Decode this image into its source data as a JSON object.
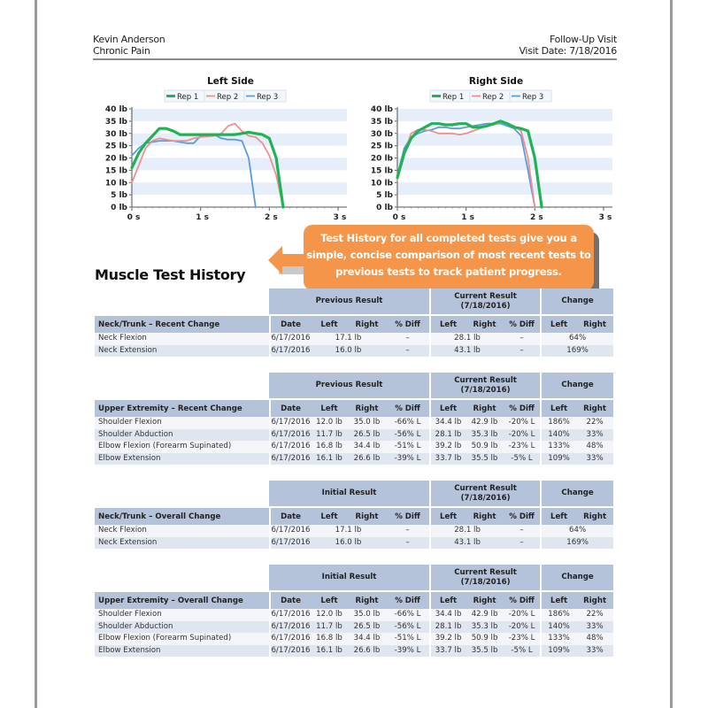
{
  "header": {
    "patient_name": "Kevin Anderson",
    "condition": "Chronic Pain",
    "visit_type": "Follow-Up Visit",
    "visit_date": "Visit Date: 7/18/2016"
  },
  "chart_data": [
    {
      "type": "line",
      "title": "Left Side",
      "xlabel": "",
      "ylabel": "",
      "xlim": [
        0,
        3
      ],
      "ylim": [
        0,
        40
      ],
      "x_ticks": [
        "0 s",
        "1 s",
        "2 s",
        "3 s"
      ],
      "y_ticks": [
        "0 lb",
        "5 lb",
        "10 lb",
        "15 lb",
        "20 lb",
        "25 lb",
        "30 lb",
        "35 lb",
        "40 lb"
      ],
      "legend": "top",
      "grid": "horizontal-bands",
      "series": [
        {
          "name": "Rep 1",
          "color": "#1fb356",
          "x": [
            0,
            0.1,
            0.2,
            0.3,
            0.4,
            0.5,
            0.6,
            0.7,
            0.8,
            0.9,
            1.0,
            1.2,
            1.4,
            1.5,
            1.6,
            1.7,
            1.8,
            1.9,
            2.0,
            2.1,
            2.2
          ],
          "y": [
            16,
            22,
            26,
            29,
            32,
            32,
            31,
            29.5,
            29.5,
            29.5,
            29.5,
            29.5,
            29.5,
            29.5,
            30,
            30.5,
            30,
            29.5,
            28,
            20,
            0
          ]
        },
        {
          "name": "Rep 2",
          "color": "#ef8f8f",
          "x": [
            0,
            0.1,
            0.2,
            0.3,
            0.4,
            0.5,
            0.6,
            0.7,
            0.8,
            0.9,
            1.0,
            1.2,
            1.3,
            1.4,
            1.5,
            1.6,
            1.7,
            1.8,
            1.9,
            2.0,
            2.1,
            2.2
          ],
          "y": [
            10,
            17,
            24,
            27,
            28,
            27.5,
            27,
            27,
            27,
            28,
            28.5,
            29,
            30,
            33,
            34,
            31,
            29,
            28.5,
            26,
            21,
            13,
            0
          ]
        },
        {
          "name": "Rep 3",
          "color": "#5b9bdc",
          "x": [
            0,
            0.1,
            0.2,
            0.3,
            0.4,
            0.5,
            0.6,
            0.7,
            0.8,
            0.9,
            1.0,
            1.1,
            1.2,
            1.3,
            1.4,
            1.5,
            1.6,
            1.7,
            1.75,
            1.8
          ],
          "y": [
            21,
            24,
            26,
            26.5,
            27,
            27,
            27,
            26.5,
            26,
            26,
            29,
            29.5,
            29.5,
            28,
            27.5,
            27.5,
            27,
            20,
            10,
            0
          ]
        }
      ]
    },
    {
      "type": "line",
      "title": "Right Side",
      "xlabel": "",
      "ylabel": "",
      "xlim": [
        0,
        3
      ],
      "ylim": [
        0,
        40
      ],
      "x_ticks": [
        "0 s",
        "1 s",
        "2 s",
        "3 s"
      ],
      "y_ticks": [
        "0 lb",
        "5 lb",
        "10 lb",
        "15 lb",
        "20 lb",
        "25 lb",
        "30 lb",
        "35 lb",
        "40 lb"
      ],
      "legend": "top",
      "grid": "horizontal-bands",
      "series": [
        {
          "name": "Rep 1",
          "color": "#1fb356",
          "x": [
            0,
            0.1,
            0.2,
            0.3,
            0.4,
            0.5,
            0.6,
            0.7,
            0.8,
            0.9,
            1.0,
            1.1,
            1.2,
            1.3,
            1.4,
            1.5,
            1.6,
            1.7,
            1.8,
            1.9,
            2.0,
            2.05,
            2.1
          ],
          "y": [
            12,
            22,
            28,
            31,
            32.5,
            34,
            34,
            33.5,
            33.5,
            34,
            34,
            32.5,
            32.5,
            33,
            34,
            35,
            34,
            32.5,
            32,
            31,
            20,
            10,
            0
          ]
        },
        {
          "name": "Rep 2",
          "color": "#ef8f8f",
          "x": [
            0,
            0.1,
            0.2,
            0.3,
            0.4,
            0.5,
            0.6,
            0.7,
            0.8,
            0.9,
            1.0,
            1.1,
            1.2,
            1.3,
            1.4,
            1.5,
            1.6,
            1.7,
            1.8,
            1.9,
            2.0
          ],
          "y": [
            11,
            22,
            30,
            31.5,
            31.5,
            31,
            30,
            30,
            30,
            29.5,
            30,
            31,
            32,
            33,
            33.5,
            34.5,
            34,
            33,
            31,
            20,
            0
          ]
        },
        {
          "name": "Rep 3",
          "color": "#5b9bdc",
          "x": [
            0,
            0.1,
            0.2,
            0.3,
            0.4,
            0.5,
            0.6,
            0.7,
            0.8,
            0.9,
            1.0,
            1.1,
            1.2,
            1.3,
            1.4,
            1.5,
            1.6,
            1.7,
            1.8,
            1.9,
            2.0
          ],
          "y": [
            13,
            24,
            28.5,
            30,
            31,
            31.5,
            32.5,
            32.5,
            32,
            32,
            32.5,
            33,
            33.5,
            34,
            34,
            34,
            33,
            32,
            29,
            15,
            0
          ]
        }
      ]
    }
  ],
  "callout": {
    "text_lines": [
      "Test History for all completed tests give you a",
      "simple, concise comparison of most recent tests to",
      "previous tests to track patient progress."
    ],
    "color": "#f4954a"
  },
  "section_title": "Muscle Test History",
  "tables": [
    {
      "baseline_group": "Previous Result",
      "current_group": "Current Result",
      "current_date": "(7/18/2016)",
      "change_group": "Change",
      "row_header": "Neck/Trunk – Recent Change",
      "columns": [
        "Date",
        "Left",
        "Right",
        "% Diff",
        "Left",
        "Right",
        "% Diff",
        "Left",
        "Right"
      ],
      "merged": true,
      "rows": [
        {
          "name": "Neck Flexion",
          "date": "6/17/2016",
          "prev": "17.1 lb",
          "prev_diff": "–",
          "curr": "28.1 lb",
          "curr_diff": "–",
          "change": "64%"
        },
        {
          "name": "Neck Extension",
          "date": "6/17/2016",
          "prev": "16.0 lb",
          "prev_diff": "–",
          "curr": "43.1 lb",
          "curr_diff": "–",
          "change": "169%"
        }
      ]
    },
    {
      "baseline_group": "Previous Result",
      "current_group": "Current Result",
      "current_date": "(7/18/2016)",
      "change_group": "Change",
      "row_header": "Upper Extremity – Recent Change",
      "columns": [
        "Date",
        "Left",
        "Right",
        "% Diff",
        "Left",
        "Right",
        "% Diff",
        "Left",
        "Right"
      ],
      "merged": false,
      "rows": [
        {
          "name": "Shoulder Flexion",
          "cells": [
            "6/17/2016",
            "12.0 lb",
            "35.0 lb",
            "-66% L",
            "34.4 lb",
            "42.9 lb",
            "-20% L",
            "186%",
            "22%"
          ]
        },
        {
          "name": "Shoulder Abduction",
          "cells": [
            "6/17/2016",
            "11.7 lb",
            "26.5 lb",
            "-56% L",
            "28.1 lb",
            "35.3 lb",
            "-20% L",
            "140%",
            "33%"
          ]
        },
        {
          "name": "Elbow Flexion (Forearm Supinated)",
          "cells": [
            "6/17/2016",
            "16.8 lb",
            "34.4 lb",
            "-51% L",
            "39.2 lb",
            "50.9 lb",
            "-23% L",
            "133%",
            "48%"
          ]
        },
        {
          "name": "Elbow Extension",
          "cells": [
            "6/17/2016",
            "16.1 lb",
            "26.6 lb",
            "-39% L",
            "33.7 lb",
            "35.5 lb",
            "-5% L",
            "109%",
            "33%"
          ]
        }
      ]
    },
    {
      "baseline_group": "Initial Result",
      "current_group": "Current Result",
      "current_date": "(7/18/2016)",
      "change_group": "Change",
      "row_header": "Neck/Trunk – Overall Change",
      "columns": [
        "Date",
        "Left",
        "Right",
        "% Diff",
        "Left",
        "Right",
        "% Diff",
        "Left",
        "Right"
      ],
      "merged": true,
      "rows": [
        {
          "name": "Neck Flexion",
          "date": "6/17/2016",
          "prev": "17.1 lb",
          "prev_diff": "–",
          "curr": "28.1 lb",
          "curr_diff": "–",
          "change": "64%"
        },
        {
          "name": "Neck Extension",
          "date": "6/17/2016",
          "prev": "16.0 lb",
          "prev_diff": "–",
          "curr": "43.1 lb",
          "curr_diff": "–",
          "change": "169%"
        }
      ]
    },
    {
      "baseline_group": "Initial Result",
      "current_group": "Current Result",
      "current_date": "(7/18/2016)",
      "change_group": "Change",
      "row_header": "Upper Extremity – Overall Change",
      "columns": [
        "Date",
        "Left",
        "Right",
        "% Diff",
        "Left",
        "Right",
        "% Diff",
        "Left",
        "Right"
      ],
      "merged": false,
      "rows": [
        {
          "name": "Shoulder Flexion",
          "cells": [
            "6/17/2016",
            "12.0 lb",
            "35.0 lb",
            "-66% L",
            "34.4 lb",
            "42.9 lb",
            "-20% L",
            "186%",
            "22%"
          ]
        },
        {
          "name": "Shoulder Abduction",
          "cells": [
            "6/17/2016",
            "11.7 lb",
            "26.5 lb",
            "-56% L",
            "28.1 lb",
            "35.3 lb",
            "-20% L",
            "140%",
            "33%"
          ]
        },
        {
          "name": "Elbow Flexion (Forearm Supinated)",
          "cells": [
            "6/17/2016",
            "16.8 lb",
            "34.4 lb",
            "-51% L",
            "39.2 lb",
            "50.9 lb",
            "-23% L",
            "133%",
            "48%"
          ]
        },
        {
          "name": "Elbow Extension",
          "cells": [
            "6/17/2016",
            "16.1 lb",
            "26.6 lb",
            "-39% L",
            "33.7 lb",
            "35.5 lb",
            "-5% L",
            "109%",
            "33%"
          ]
        }
      ]
    }
  ]
}
